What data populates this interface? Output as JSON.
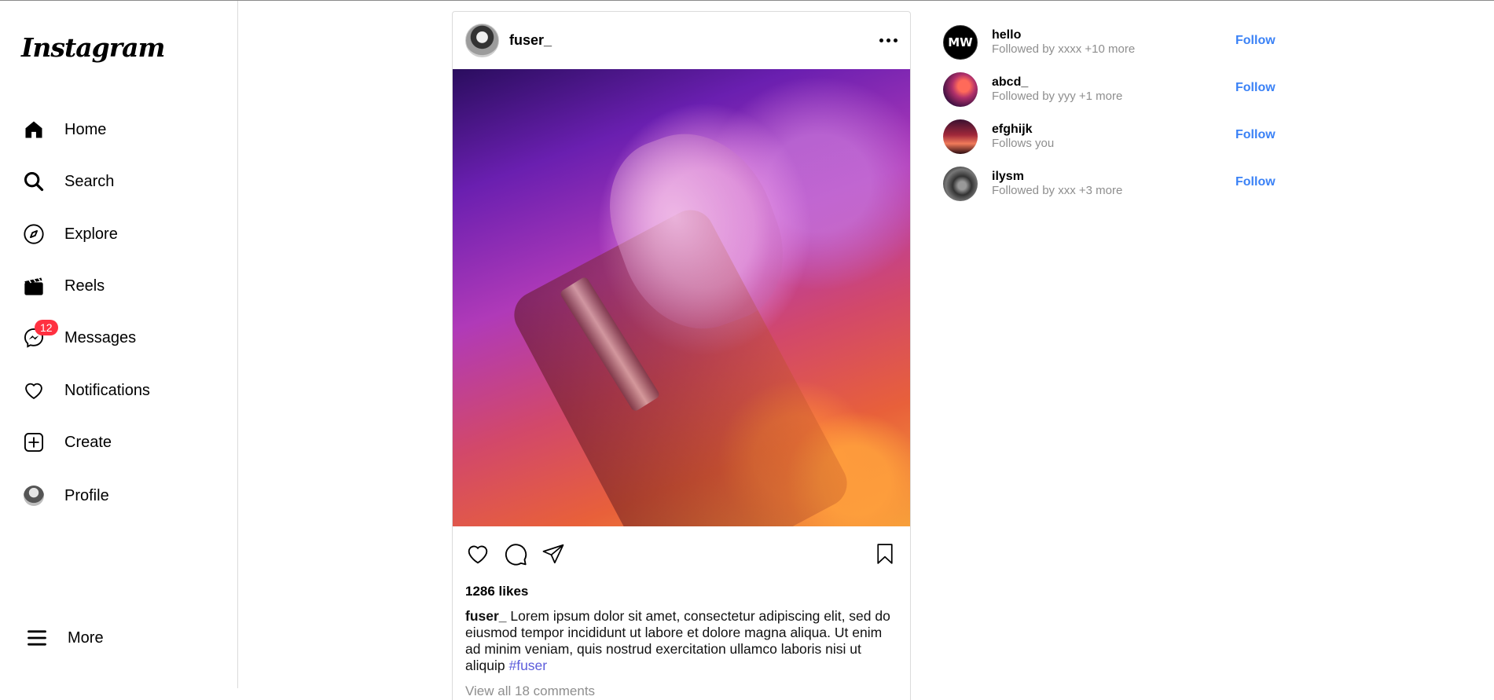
{
  "app": {
    "logo_text": "Instagram"
  },
  "sidebar": {
    "items": [
      {
        "label": "Home",
        "icon": "home-icon"
      },
      {
        "label": "Search",
        "icon": "search-icon"
      },
      {
        "label": "Explore",
        "icon": "compass-icon"
      },
      {
        "label": "Reels",
        "icon": "reels-icon"
      },
      {
        "label": "Messages",
        "icon": "messenger-icon",
        "badge": "12"
      },
      {
        "label": "Notifications",
        "icon": "heart-icon"
      },
      {
        "label": "Create",
        "icon": "plus-square-icon"
      },
      {
        "label": "Profile",
        "icon": "avatar"
      }
    ],
    "more_label": "More"
  },
  "post": {
    "username": "fuser_",
    "likes": "1286 likes",
    "caption_user": "fuser_",
    "caption_text": "Lorem ipsum dolor sit amet, consectetur adipiscing elit, sed do eiusmod tempor incididunt ut labore et dolore magna aliqua. Ut enim ad minim veniam, quis nostrud exercitation ullamco laboris nisi ut aliquip",
    "hashtag": "#fuser",
    "view_comments": "View all 18 comments"
  },
  "suggestions": [
    {
      "name": "hello",
      "subtitle": "Followed by xxxx +10 more",
      "follow_label": "Follow",
      "avatar_text": "MW"
    },
    {
      "name": "abcd_",
      "subtitle": "Followed by yyy +1 more",
      "follow_label": "Follow"
    },
    {
      "name": "efghijk",
      "subtitle": "Follows you",
      "follow_label": "Follow"
    },
    {
      "name": "ilysm",
      "subtitle": "Followed by xxx +3 more",
      "follow_label": "Follow"
    }
  ],
  "colors": {
    "accent": "#3b82f6",
    "hashtag": "#5b5bdb",
    "badge": "#ff3040",
    "muted": "#8e8e8e"
  }
}
